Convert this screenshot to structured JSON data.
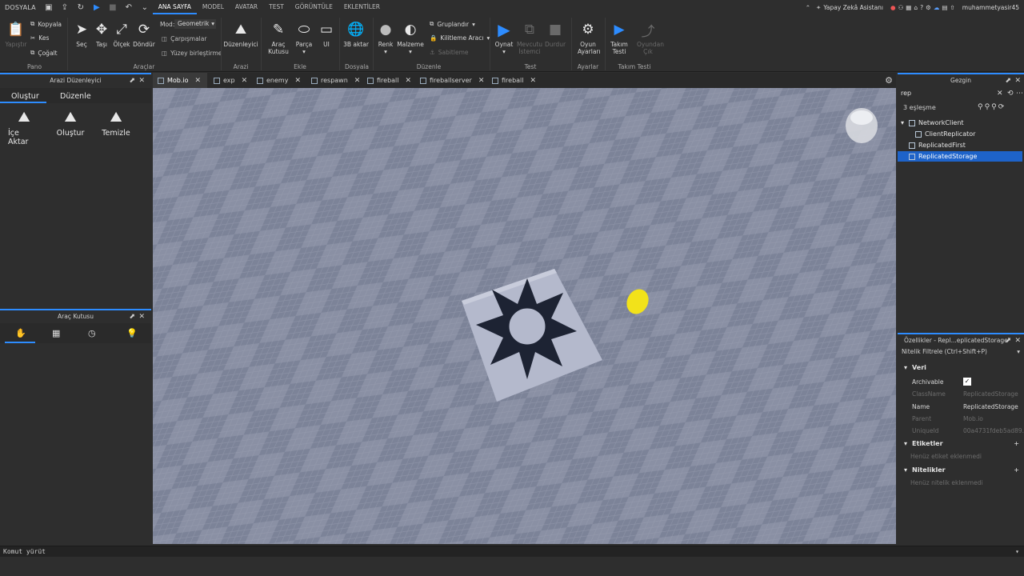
{
  "menubar": {
    "file_label": "DOSYALA",
    "tabs": [
      "ANA SAYFA",
      "MODEL",
      "AVATAR",
      "TEST",
      "GÖRÜNTÜLE",
      "EKLENTİLER"
    ],
    "assistant_label": "Yapay Zekâ Asistanı",
    "username": "muhammetyasir45"
  },
  "ribbon": {
    "clipboard": {
      "paste": "Yapıştır",
      "copy": "Kopyala",
      "cut": "Kes",
      "duplicate": "Çoğalt",
      "group": "Pano"
    },
    "tools": {
      "select": "Seç",
      "move": "Taşı",
      "scale": "Ölçek",
      "rotate": "Döndür",
      "mode_label": "Mod:",
      "mode_value": "Geometrik",
      "collisions": "Çarpışmalar",
      "surface_join": "Yüzey birleştirme",
      "group": "Araçlar"
    },
    "terrain": {
      "editor": "Düzenleyici",
      "group": "Arazi"
    },
    "insert": {
      "toolbox": "Araç Kutusu",
      "part": "Parça",
      "ui": "UI",
      "group": "Ekle"
    },
    "file": {
      "import3d": "3B aktar",
      "group": "Dosyala"
    },
    "edit": {
      "color": "Renk",
      "material": "Malzeme",
      "group_btn": "Gruplandır",
      "lock_tool": "Kilitleme Aracı",
      "anchor": "Sabitleme",
      "group": "Düzenle"
    },
    "test": {
      "play": "Oynat",
      "current_client": "Mevcutu İstemci",
      "stop": "Durdur",
      "group": "Test"
    },
    "settings": {
      "game_settings": "Oyun Ayarları",
      "group": "Ayarlar"
    },
    "team_test": {
      "team_test": "Takım Testi",
      "exit_game": "Oyundan Çık",
      "group": "Takım Testi"
    }
  },
  "doc_tabs": [
    "Mob.io",
    "exp",
    "enemy",
    "respawn",
    "fireball",
    "fireballserver",
    "fireball"
  ],
  "terrain_panel": {
    "title": "Arazi Düzenleyici",
    "tabs": [
      "Oluştur",
      "Düzenle"
    ],
    "tools": [
      "İçe Aktar",
      "Oluştur",
      "Temizle"
    ]
  },
  "toolbox_panel": {
    "title": "Araç Kutusu"
  },
  "explorer": {
    "title": "Gezgin",
    "search_value": "rep",
    "match_count": "3 eşleşme",
    "items": [
      {
        "label": "NetworkClient",
        "indent": 0,
        "selected": false
      },
      {
        "label": "ClientReplicator",
        "indent": 1,
        "selected": false
      },
      {
        "label": "ReplicatedFirst",
        "indent": 0,
        "selected": false
      },
      {
        "label": "ReplicatedStorage",
        "indent": 0,
        "selected": true
      }
    ]
  },
  "properties": {
    "title": "Özellikler - Repl...eplicatedStorage\"",
    "filter_placeholder": "Nitelik Filtrele (Ctrl+Shift+P)",
    "section_data": "Veri",
    "rows": [
      {
        "key": "Archivable",
        "value": "",
        "checkbox": true,
        "dim": false
      },
      {
        "key": "ClassName",
        "value": "ReplicatedStorage",
        "dim": true
      },
      {
        "key": "Name",
        "value": "ReplicatedStorage",
        "dim": false
      },
      {
        "key": "Parent",
        "value": "Mob.io",
        "dim": true
      },
      {
        "key": "UniqueId",
        "value": "00a4731fdeb5ad89...",
        "dim": true
      }
    ],
    "section_tags": "Etiketler",
    "tags_empty": "Henüz etiket eklenmedi",
    "section_attrs": "Nitelikler",
    "attrs_empty": "Henüz nitelik eklenmedi"
  },
  "command_bar": {
    "placeholder": "Komut yürüt"
  }
}
